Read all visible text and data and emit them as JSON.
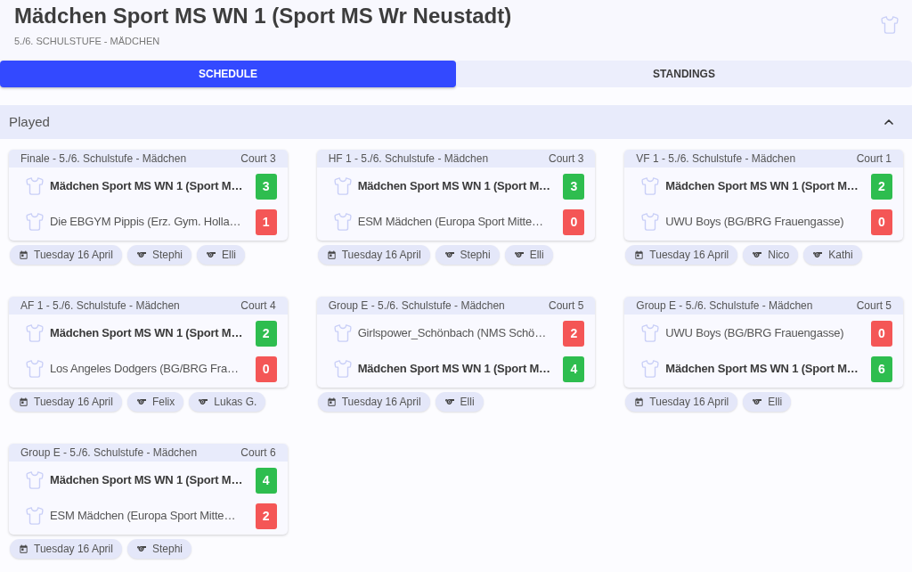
{
  "header": {
    "title": "Mädchen Sport MS WN 1 (Sport MS Wr Neustadt)",
    "subtitle": "5./6. SCHULSTUFE - MÄDCHEN"
  },
  "tabs": [
    {
      "label": "SCHEDULE",
      "selected": true
    },
    {
      "label": "STANDINGS",
      "selected": false
    }
  ],
  "section": {
    "title": "Played",
    "expanded": true
  },
  "matches": [
    {
      "round": "Finale - 5./6. Schulstufe - Mädchen",
      "court": "Court 3",
      "teams": [
        {
          "name": "Mädchen Sport MS WN 1 (Sport M…",
          "score": "3",
          "highlighted": true,
          "won": true
        },
        {
          "name": "Die EBGYM Pippis (Erz. Gym. Holla…",
          "score": "1",
          "highlighted": false,
          "won": false
        }
      ],
      "date": "Tuesday 16 April",
      "referees": [
        "Stephi",
        "Elli"
      ]
    },
    {
      "round": "HF 1 - 5./6. Schulstufe - Mädchen",
      "court": "Court 3",
      "teams": [
        {
          "name": "Mädchen Sport MS WN 1 (Sport M…",
          "score": "3",
          "highlighted": true,
          "won": true
        },
        {
          "name": "ESM Mädchen (Europa Sport Mitte…",
          "score": "0",
          "highlighted": false,
          "won": false
        }
      ],
      "date": "Tuesday 16 April",
      "referees": [
        "Stephi",
        "Elli"
      ]
    },
    {
      "round": "VF 1 - 5./6. Schulstufe - Mädchen",
      "court": "Court 1",
      "teams": [
        {
          "name": "Mädchen Sport MS WN 1 (Sport M…",
          "score": "2",
          "highlighted": true,
          "won": true
        },
        {
          "name": "UWU Boys (BG/BRG Frauengasse)",
          "score": "0",
          "highlighted": false,
          "won": false
        }
      ],
      "date": "Tuesday 16 April",
      "referees": [
        "Nico",
        "Kathi"
      ]
    },
    {
      "round": "AF 1 - 5./6. Schulstufe - Mädchen",
      "court": "Court 4",
      "teams": [
        {
          "name": "Mädchen Sport MS WN 1 (Sport M…",
          "score": "2",
          "highlighted": true,
          "won": true
        },
        {
          "name": "Los Angeles Dodgers (BG/BRG Fra…",
          "score": "0",
          "highlighted": false,
          "won": false
        }
      ],
      "date": "Tuesday 16 April",
      "referees": [
        "Felix",
        "Lukas G."
      ]
    },
    {
      "round": "Group E - 5./6. Schulstufe - Mädchen",
      "court": "Court 5",
      "teams": [
        {
          "name": "Girlspower_Schönbach (NMS Schö…",
          "score": "2",
          "highlighted": false,
          "won": false
        },
        {
          "name": "Mädchen Sport MS WN 1 (Sport M…",
          "score": "4",
          "highlighted": true,
          "won": true
        }
      ],
      "date": "Tuesday 16 April",
      "referees": [
        "Elli"
      ]
    },
    {
      "round": "Group E - 5./6. Schulstufe - Mädchen",
      "court": "Court 5",
      "teams": [
        {
          "name": "UWU Boys (BG/BRG Frauengasse)",
          "score": "0",
          "highlighted": false,
          "won": false
        },
        {
          "name": "Mädchen Sport MS WN 1 (Sport M…",
          "score": "6",
          "highlighted": true,
          "won": true
        }
      ],
      "date": "Tuesday 16 April",
      "referees": [
        "Elli"
      ]
    },
    {
      "round": "Group E - 5./6. Schulstufe - Mädchen",
      "court": "Court 6",
      "teams": [
        {
          "name": "Mädchen Sport MS WN 1 (Sport M…",
          "score": "4",
          "highlighted": true,
          "won": true
        },
        {
          "name": "ESM Mädchen (Europa Sport Mitte…",
          "score": "2",
          "highlighted": false,
          "won": false
        }
      ],
      "date": "Tuesday 16 April",
      "referees": [
        "Stephi"
      ]
    }
  ]
}
